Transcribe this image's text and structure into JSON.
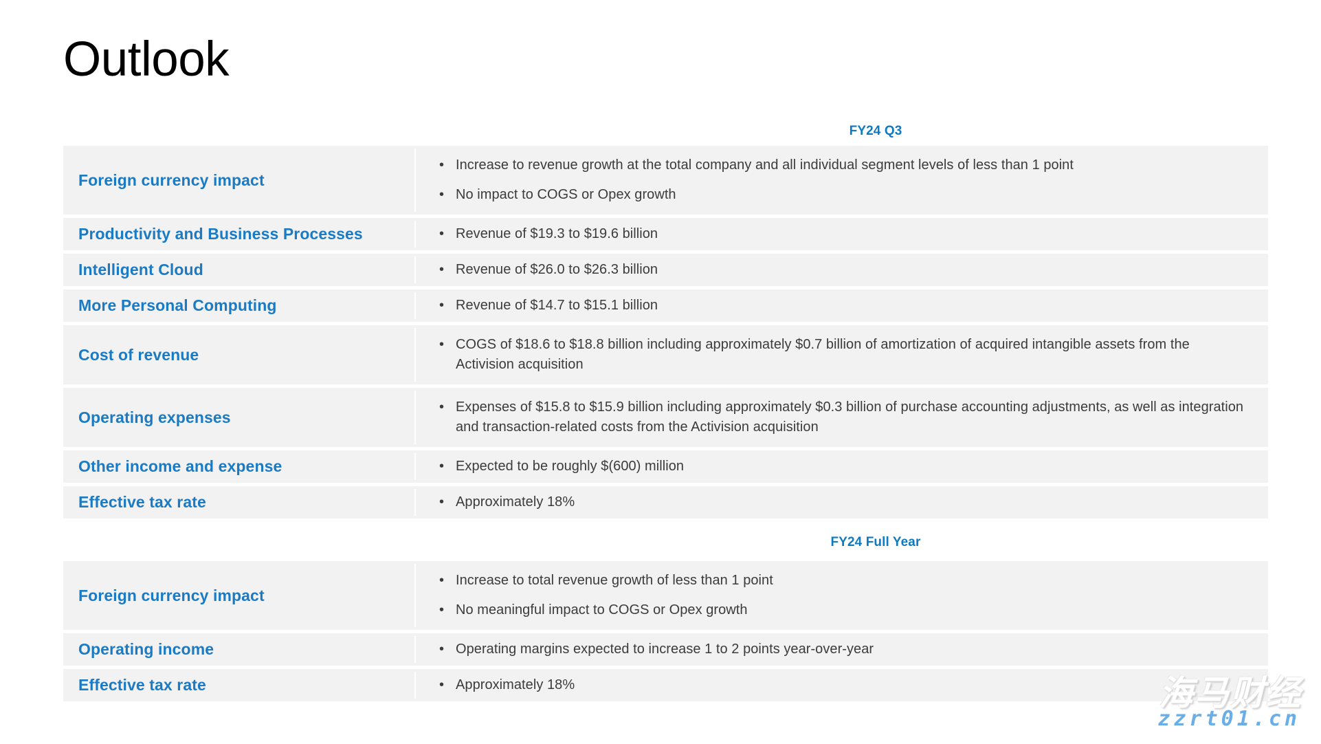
{
  "page_title": "Outlook",
  "colors": {
    "accent_blue": "#1a7bc4",
    "caption_blue": "#0f7ac0",
    "row_background": "#f2f2f2",
    "body_text": "#3b3b3b",
    "title_text": "#000000",
    "watermark_url_blue": "#6aaee8"
  },
  "bullet_glyph": "•",
  "sections": [
    {
      "caption": "FY24 Q3",
      "rows": [
        {
          "label": "Foreign currency impact",
          "bullets": [
            "Increase to revenue growth at the total company and all individual segment levels of less than 1 point",
            "No impact to COGS or Opex growth"
          ]
        },
        {
          "label": "Productivity and Business Processes",
          "bullets": [
            "Revenue of $19.3 to $19.6 billion"
          ]
        },
        {
          "label": "Intelligent Cloud",
          "bullets": [
            "Revenue of $26.0 to $26.3 billion"
          ]
        },
        {
          "label": "More Personal Computing",
          "bullets": [
            "Revenue of $14.7 to $15.1 billion"
          ]
        },
        {
          "label": "Cost of revenue",
          "bullets": [
            "COGS of $18.6 to $18.8 billion including approximately $0.7 billion of amortization of acquired intangible assets from the Activision acquisition"
          ]
        },
        {
          "label": "Operating expenses",
          "bullets": [
            "Expenses of $15.8 to $15.9 billion including approximately $0.3 billion of purchase accounting adjustments, as well as integration and transaction-related costs from the Activision acquisition"
          ]
        },
        {
          "label": "Other income and expense",
          "bullets": [
            "Expected to be roughly $(600) million"
          ]
        },
        {
          "label": "Effective tax rate",
          "bullets": [
            "Approximately 18%"
          ]
        }
      ]
    },
    {
      "caption": "FY24 Full Year",
      "rows": [
        {
          "label": "Foreign currency impact",
          "bullets": [
            "Increase to total revenue growth of less than 1 point",
            "No meaningful impact to COGS or Opex growth"
          ]
        },
        {
          "label": "Operating income",
          "bullets": [
            "Operating margins expected to increase 1 to 2 points year-over-year"
          ]
        },
        {
          "label": "Effective tax rate",
          "bullets": [
            "Approximately 18%"
          ]
        }
      ]
    }
  ],
  "watermark": {
    "brand": "海马财经",
    "url": "zzrt01.cn"
  }
}
